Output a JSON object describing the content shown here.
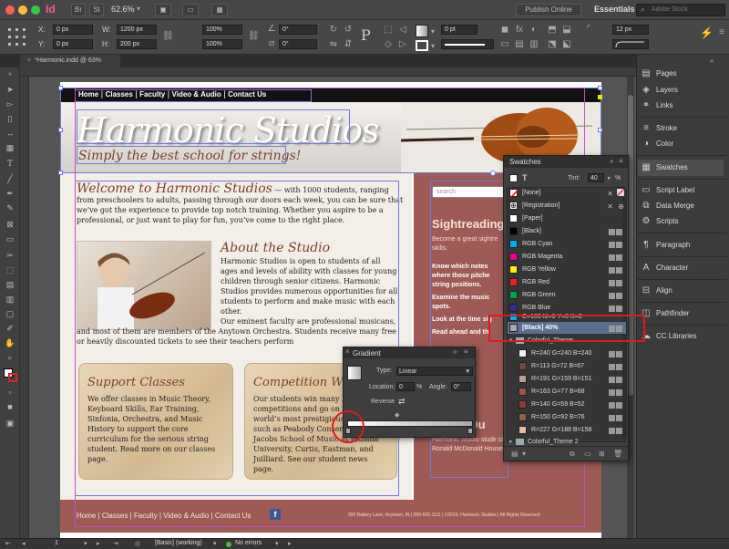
{
  "app": {
    "logo": "Id",
    "zoom": "62.6%",
    "publish_label": "Publish Online",
    "workspace": "Essentials",
    "search_placeholder": "Adobe Stock"
  },
  "control": {
    "x_label": "X:",
    "y_label": "Y:",
    "w_label": "W:",
    "h_label": "H:",
    "x": "0 px",
    "y": "0 px",
    "w": "1200 px",
    "h": "200 px",
    "scale_x": "100%",
    "scale_y": "100%",
    "rotate": "0°",
    "shear": "0°",
    "stroke_weight": "0 pt",
    "corner": "12 px"
  },
  "document_tab": "*Harmonic.indd @ 63%",
  "website": {
    "nav": [
      "Home",
      "Classes",
      "Faculty",
      "Video & Audio",
      "Contact Us"
    ],
    "title": "Harmonic Studios",
    "tagline": "Simply the best school for strings!",
    "welcome_heading": "Welcome to Harmonic Studios",
    "welcome_text": "— with 1000 students, ranging from preschoolers to adults, passing through our doors each week, you can be sure that we’ve got the experience to provide top notch training. Whether you aspire to be a professional, or just want to play for fun, you’ve come to the right place.",
    "about_heading": "About the Studio",
    "about_text1": "Harmonic Studios is open to students of all ages and levels of ability with classes for young children through senior citizens. Harmonic Studios provides numerous opportunities for all students to perform and make music with each other.",
    "about_text2": "Our eminent faculty are professional musicans, and most of them are members of the Anytown Orchestra. Students receive many free or heavily discounted tickets to see their teachers perform",
    "support_heading": "Support Classes",
    "support_text": "We offer classes in Music Theory, Keyboard Skills, Ear Training, Sinfonia, Orchestra, and Music History to support the core curriculum for the serious string student. Read more on our classes page.",
    "competition_heading": "Competition Wi",
    "competition_text": "Our students win many local competitions and go on to the world’s most prestigious institutions such as Peabody Conservatory, Jacobs School of Music at Indiana University, Curtis, Eastman, and Juilliard. See our student news page.",
    "search_placeholder": "search",
    "side_heading": "Sightreading",
    "side_intro": "Become a great sightre skills:",
    "side_bullets": [
      "Know which notes where those pitche string positions.",
      "Examine the music spots.",
      "Look at the time sig",
      "Read ahead and th"
    ],
    "side_bottom_heading": "Music Ou",
    "side_bottom_text": "Harmonic Studio stude city schools, giving their and at Ronald McDonald House.",
    "footer_links": [
      "Home",
      "Classes",
      "Faculty",
      "Video & Audio",
      "Contact Us"
    ],
    "footer_address": "900 Battery Lane, Anytown, IN | 999-555-1111 | ©2016, Harmonic Studios | All Rights Reserved"
  },
  "dock": {
    "items": [
      "Pages",
      "Layers",
      "Links",
      "Stroke",
      "Color",
      "Swatches",
      "Script Label",
      "Data Merge",
      "Scripts",
      "Paragraph",
      "Character",
      "Align",
      "Pathfinder",
      "CC Libraries"
    ]
  },
  "swatches": {
    "title": "Swatches",
    "tint_label": "Tint:",
    "tint_value": "40",
    "tint_unit": "%",
    "items": [
      {
        "name": "[None]",
        "color": "#ffffff"
      },
      {
        "name": "[Registration]",
        "color": "#000000"
      },
      {
        "name": "[Paper]",
        "color": "#ffffff"
      },
      {
        "name": "[Black]",
        "color": "#000000"
      },
      {
        "name": "RGB Cyan",
        "color": "#00aeef"
      },
      {
        "name": "RGB Magenta",
        "color": "#ec008c"
      },
      {
        "name": "RGB Yellow",
        "color": "#fff200"
      },
      {
        "name": "RGB Red",
        "color": "#ed1c24"
      },
      {
        "name": "RGB Green",
        "color": "#00a651"
      },
      {
        "name": "RGB Blue",
        "color": "#2e3192"
      },
      {
        "name": "C=100 M=0 Y=0 K=0",
        "color": "#00aeef"
      },
      {
        "name": "[Black] 40%",
        "color": "#a7a9ac"
      },
      {
        "name": "Colorful_Theme",
        "color": "#3e3e3e"
      },
      {
        "name": "R=240 G=240 B=240",
        "color": "#f0f0f0"
      },
      {
        "name": "R=113 G=72 B=67",
        "color": "#714843"
      },
      {
        "name": "R=191 G=159 B=151",
        "color": "#bf9f97"
      },
      {
        "name": "R=163 G=77 B=68",
        "color": "#a34d44"
      },
      {
        "name": "R=140 G=59 B=52",
        "color": "#8c3b34"
      },
      {
        "name": "R=150 G=92 B=76",
        "color": "#965c4c"
      },
      {
        "name": "R=227 G=188 B=158",
        "color": "#e3bc9e"
      },
      {
        "name": "Colorful_Theme 2",
        "color": "#3e3e3e"
      }
    ]
  },
  "gradient": {
    "title": "Gradient",
    "type_label": "Type:",
    "type_value": "Linear",
    "location_label": "Location:",
    "location_value": "0",
    "location_unit": "%",
    "angle_label": "Angle:",
    "angle_value": "0°",
    "reverse_label": "Reverse"
  },
  "status": {
    "page": "1",
    "style": "[Basic] (working)",
    "errors": "No errors"
  }
}
